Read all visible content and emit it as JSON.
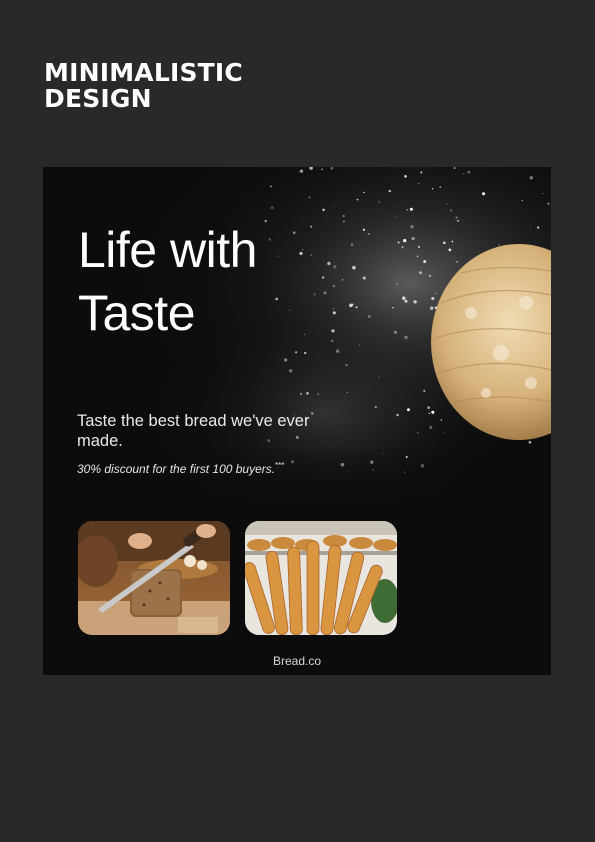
{
  "heading": {
    "line1": "MINIMALISTIC",
    "line2": "DESIGN"
  },
  "poster": {
    "title_line1": "Life with",
    "title_line2": "Taste",
    "tagline": "Taste the best bread we've ever made.",
    "discount": "30% discount for the first 100 buyers.",
    "discount_mark": "***",
    "brand": "Bread.co",
    "photos": [
      {
        "subject": "bread-cutting-photo"
      },
      {
        "subject": "baguettes-photo"
      }
    ]
  },
  "colors": {
    "page_background": "#282a29",
    "poster_background": "#0d0c0c",
    "text": "#ffffff"
  }
}
